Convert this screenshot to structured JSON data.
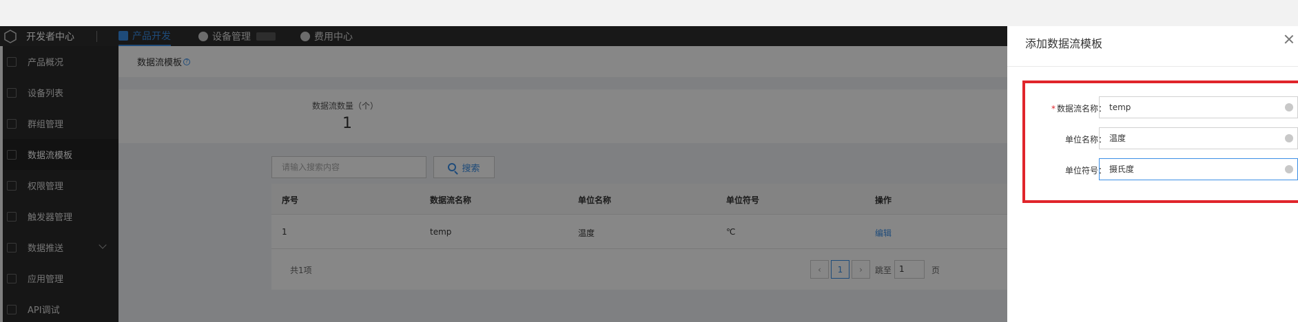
{
  "header": {
    "brand": "开发者中心",
    "tabs": [
      {
        "label": "产品开发",
        "active": true
      },
      {
        "label": "设备管理",
        "active": false
      },
      {
        "label": "费用中心",
        "active": false
      }
    ]
  },
  "sidebar": {
    "items": [
      {
        "label": "产品概况",
        "icon": "box-icon"
      },
      {
        "label": "设备列表",
        "icon": "list-icon"
      },
      {
        "label": "群组管理",
        "icon": "grid-icon"
      },
      {
        "label": "数据流模板",
        "icon": "stream-icon",
        "active": true
      },
      {
        "label": "权限管理",
        "icon": "key-icon"
      },
      {
        "label": "触发器管理",
        "icon": "trigger-icon"
      },
      {
        "label": "数据推送",
        "icon": "push-icon",
        "expandable": true
      },
      {
        "label": "应用管理",
        "icon": "apps-icon"
      },
      {
        "label": "API调试",
        "icon": "api-icon"
      }
    ]
  },
  "main": {
    "breadcrumb": "数据流模板",
    "help_glyph": "?",
    "stat_label": "数据流数量（个）",
    "stat_value": "1",
    "search_placeholder": "请输入搜索内容",
    "search_button": "搜索",
    "table": {
      "columns": [
        "序号",
        "数据流名称",
        "单位名称",
        "单位符号",
        "操作"
      ],
      "rows": [
        {
          "index": "1",
          "name": "temp",
          "unit_name": "温度",
          "unit_symbol": "℃",
          "action": "编辑"
        }
      ]
    },
    "pagination": {
      "total_text": "共1项",
      "prev": "‹",
      "current_page": "1",
      "next": "›",
      "jump_prefix": "跳至",
      "jump_value": "1",
      "jump_suffix": "页"
    }
  },
  "drawer": {
    "title": "添加数据流模板",
    "fields": [
      {
        "label": "数据流名称：",
        "value": "temp",
        "required": true
      },
      {
        "label": "单位名称：",
        "value": "温度",
        "required": false
      },
      {
        "label": "单位符号：",
        "value": "摄氏度",
        "required": false,
        "focused": true
      }
    ],
    "required_mark": "*"
  },
  "colors": {
    "accent": "#3a8ee6",
    "highlight": "#e0252b",
    "sidebar_bg": "#2b2b2b"
  }
}
